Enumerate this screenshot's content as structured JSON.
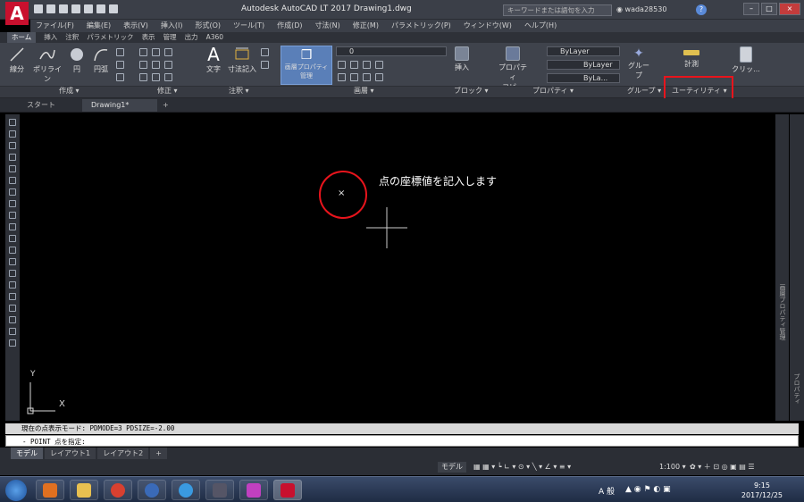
{
  "title": {
    "app_letter": "A",
    "text": "Autodesk AutoCAD LT 2017    Drawing1.dwg",
    "search_placeholder": "キーワードまたは語句を入力",
    "user": "wada28530",
    "help": "?"
  },
  "menu": [
    "ファイル(F)",
    "編集(E)",
    "表示(V)",
    "挿入(I)",
    "形式(O)",
    "ツール(T)",
    "作成(D)",
    "寸法(N)",
    "修正(M)",
    "パラメトリック(P)",
    "ウィンドウ(W)",
    "ヘルプ(H)"
  ],
  "ribbon_tabs": [
    "ホーム",
    "挿入",
    "注釈",
    "パラメトリック",
    "表示",
    "管理",
    "出力",
    "A360"
  ],
  "ribbon": {
    "line": "線分",
    "polyline": "ポリライン",
    "circle": "円",
    "arc": "円弧",
    "text": "文字",
    "dimension": "寸法記入",
    "layer_props": "画層プロパティ",
    "layer_props2": "管理",
    "layer_value": "0",
    "insert": "挿入",
    "match_props": "プロパティ",
    "match_props2": "コピー",
    "bylayer1": "ByLayer",
    "bylayer2": "ByLayer",
    "bylayer3": "ByLa...",
    "group": "グループ",
    "measure": "計測",
    "clipboard": "クリッ..."
  },
  "panels": [
    "作成 ▾",
    "修正 ▾",
    "注釈 ▾",
    "画層 ▾",
    "ブロック ▾",
    "プロパティ ▾",
    "グループ ▾",
    "ユーティリティ ▾"
  ],
  "doc_tabs": {
    "start": "スタート",
    "drawing": "Drawing1*",
    "close": "×",
    "add": "+"
  },
  "canvas": {
    "annotation": "点の座標値を記入します",
    "point_mark": "×",
    "ucs_x": "X",
    "ucs_y": "Y"
  },
  "right_panel_text": "画層プロパティ管理",
  "right_panel2_text": "プロパティ",
  "command": {
    "history": "現在の点表示モード:  PDMODE=3  PDSIZE=-2.00",
    "prompt": "- POINT 点を指定:"
  },
  "layout_tabs": [
    "モデル",
    "レイアウト1",
    "レイアウト2",
    "+"
  ],
  "status": {
    "model": "モデル",
    "scale": "1:100 ▾"
  },
  "taskbar": {
    "time": "9:15",
    "date": "2017/12/25",
    "ime": "A 般"
  },
  "colors": {
    "highlight": "#e8141c",
    "accent": "#c8102e"
  }
}
